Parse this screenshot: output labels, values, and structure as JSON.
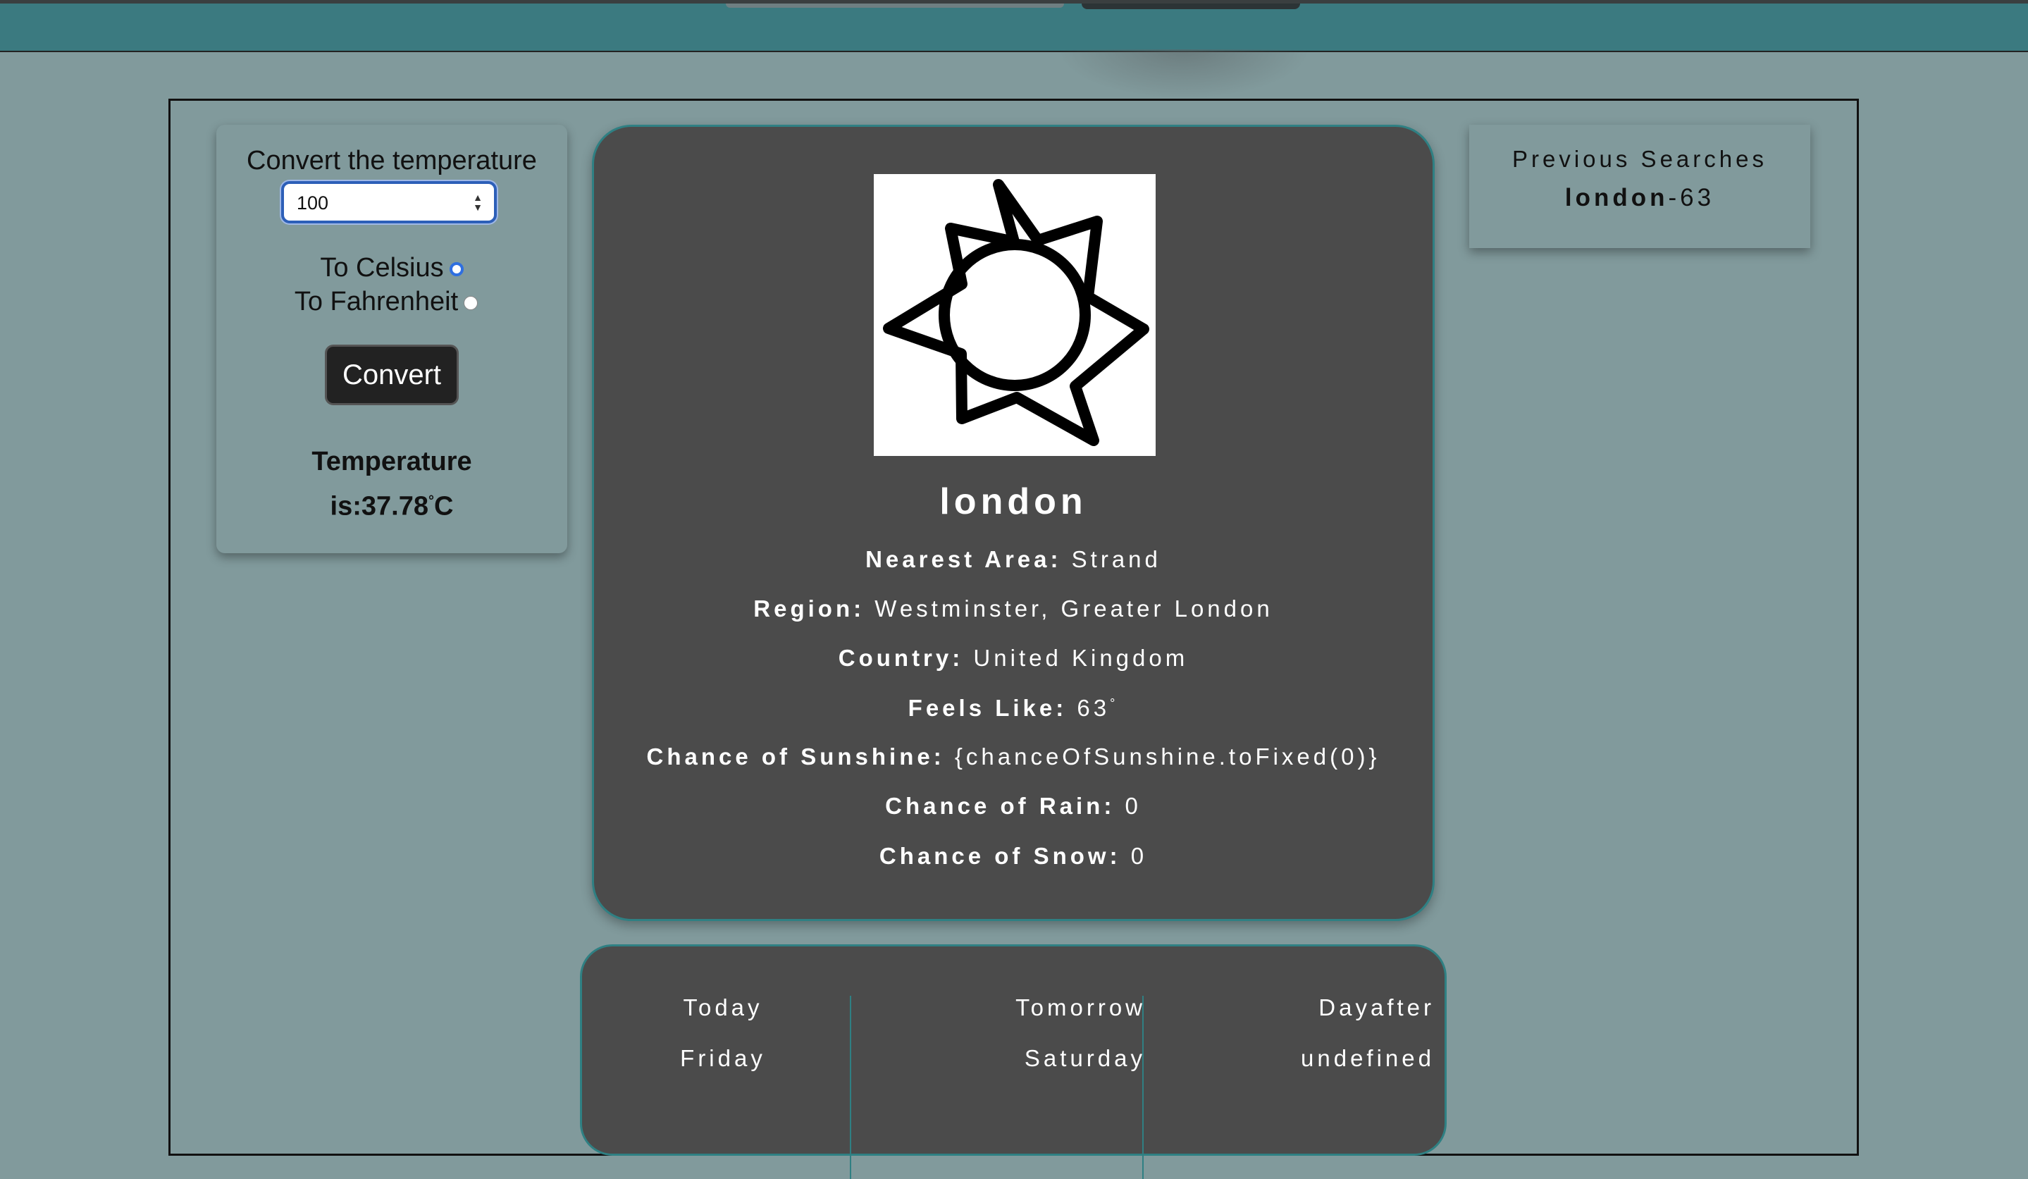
{
  "converter": {
    "title": "Convert the temperature",
    "input_value": "100",
    "option_celsius": "To Celsius",
    "option_fahrenheit": "To Fahrenheit",
    "selected": "celsius",
    "button_label": "Convert",
    "result_line1": "Temperature",
    "result_line2": "is:37.78",
    "result_degree": "°",
    "result_unit": "C"
  },
  "weather": {
    "icon": "sun-icon",
    "city": "london",
    "nearest_area_label": "Nearest Area:",
    "nearest_area": "Strand",
    "region_label": "Region:",
    "region": "Westminster, Greater London",
    "country_label": "Country:",
    "country": "United Kingdom",
    "feels_like_label": "Feels Like:",
    "feels_like": "63",
    "feels_like_degree": "°",
    "sunshine_label": "Chance of Sunshine:",
    "sunshine": "{chanceOfSunshine.toFixed(0)}",
    "rain_label": "Chance of Rain:",
    "rain": "0",
    "snow_label": "Chance of Snow:",
    "snow": "0"
  },
  "previous": {
    "title": "Previous Searches",
    "items": [
      {
        "city": "london",
        "temp": "-63"
      }
    ]
  },
  "forecast": {
    "days": [
      {
        "label": "Today",
        "day": "Friday"
      },
      {
        "label": "Tomorrow",
        "day": "Saturday"
      },
      {
        "label": "Dayafter",
        "day": "undefined"
      }
    ]
  },
  "colors": {
    "background": "#819a9c",
    "topbar": "#3b7a80",
    "card": "#4b4b4b",
    "accent_border": "#2f8083"
  }
}
